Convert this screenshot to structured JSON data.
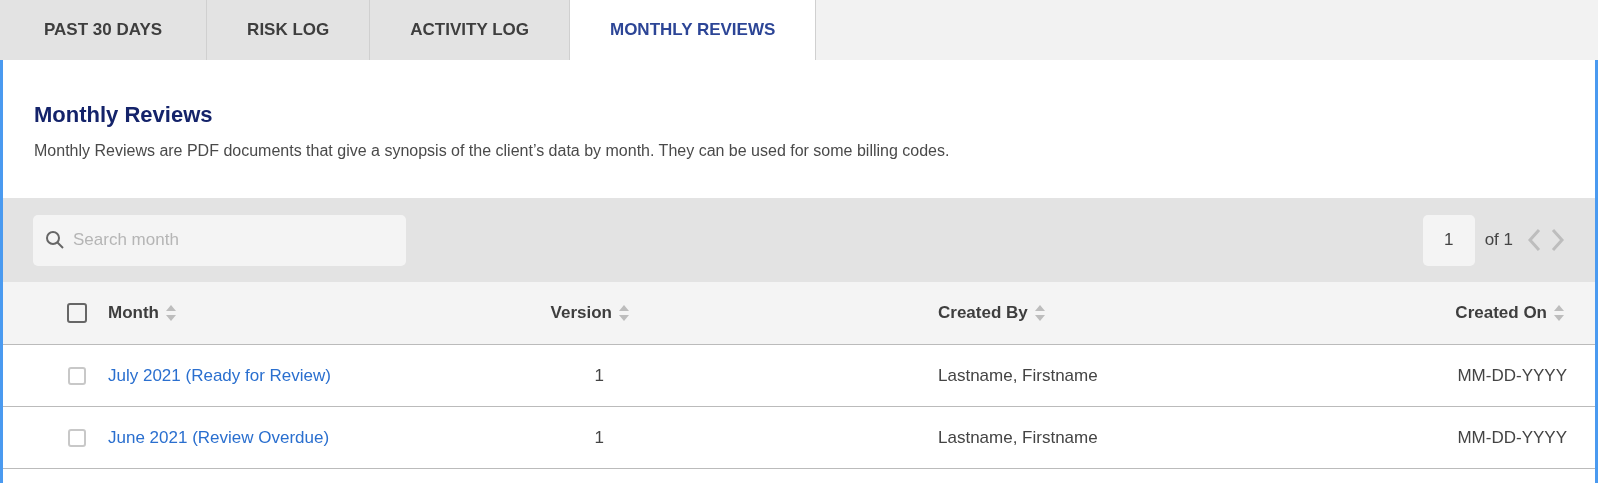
{
  "tabs": [
    {
      "label": "PAST 30 DAYS",
      "selected": false
    },
    {
      "label": "RISK LOG",
      "selected": false
    },
    {
      "label": "ACTIVITY LOG",
      "selected": false
    },
    {
      "label": "MONTHLY REVIEWS",
      "selected": true
    }
  ],
  "section": {
    "title": "Monthly Reviews",
    "description": "Monthly Reviews are PDF documents that give a synopsis of the client’s data by month. They can be used for some billing codes."
  },
  "search": {
    "placeholder": "Search month"
  },
  "pagination": {
    "page": "1",
    "of": "of 1"
  },
  "table": {
    "select_all_checked": false,
    "columns": [
      {
        "label": "Month"
      },
      {
        "label": "Version"
      },
      {
        "label": "Created By"
      },
      {
        "label": "Created On"
      }
    ],
    "rows": [
      {
        "checked": false,
        "cells": [
          "July 2021 (Ready for Review)",
          "1",
          "Lastname, Firstname",
          "MM-DD-YYYY"
        ]
      },
      {
        "checked": false,
        "cells": [
          "June 2021 (Review Overdue)",
          "1",
          "Lastname, Firstname",
          "MM-DD-YYYY"
        ]
      }
    ]
  }
}
